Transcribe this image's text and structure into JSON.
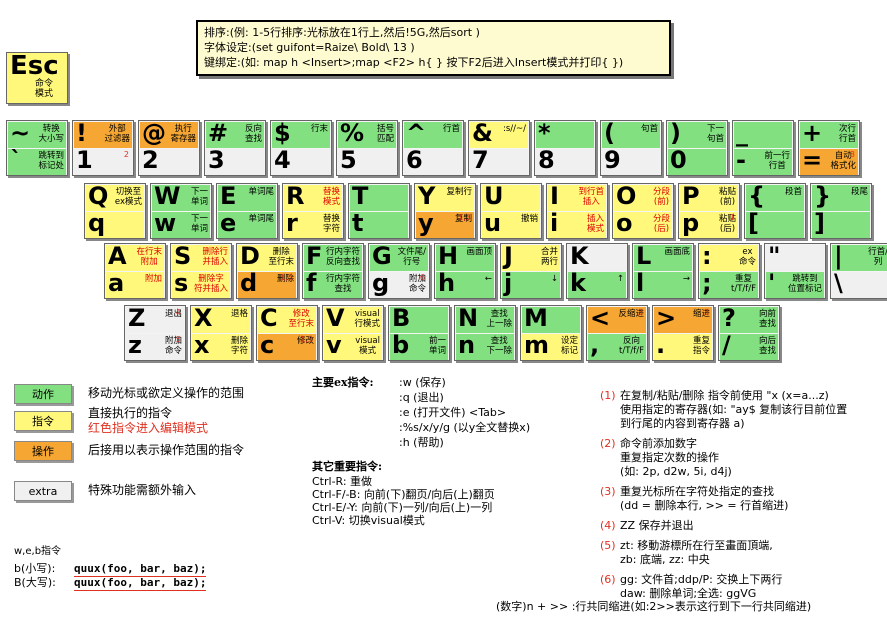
{
  "tips": [
    "排序:(例: 1-5行排序:光标放在1行上,然后!5G,然后sort )",
    "字体设定:(set guifont=Raize\\ Bold\\ 13 )",
    "键绑定:(如: map h <Insert>;map <F2> h{ } 按下F2后进入Insert模式并打印{ })"
  ],
  "esc": {
    "char": "Esc",
    "label": "命令\n模式"
  },
  "keys": [
    {
      "t": {
        "c": "~",
        "l": "转换\n大小写",
        "k": "g"
      },
      "b": {
        "c": "`",
        "l": "跳转到\n标记处",
        "k": "g"
      }
    },
    {
      "t": {
        "c": "!",
        "l": "外部\n过滤器",
        "k": "o"
      },
      "b": {
        "c": "1",
        "l": "",
        "k": "w",
        "n": "2"
      }
    },
    {
      "t": {
        "c": "@",
        "l": "执行\n寄存器",
        "k": "o"
      },
      "b": {
        "c": "2",
        "l": "",
        "k": "w"
      }
    },
    {
      "t": {
        "c": "#",
        "l": "反向\n查找",
        "k": "g"
      },
      "b": {
        "c": "3",
        "l": "",
        "k": "w"
      }
    },
    {
      "t": {
        "c": "$",
        "l": "行末",
        "k": "g"
      },
      "b": {
        "c": "4",
        "l": "",
        "k": "w"
      }
    },
    {
      "t": {
        "c": "%",
        "l": "括号\n匹配",
        "k": "g"
      },
      "b": {
        "c": "5",
        "l": "",
        "k": "w"
      }
    },
    {
      "t": {
        "c": "^",
        "l": "行首",
        "k": "g"
      },
      "b": {
        "c": "6",
        "l": "",
        "k": "w"
      }
    },
    {
      "t": {
        "c": "&",
        "l": ":s//~/",
        "k": "y"
      },
      "b": {
        "c": "7",
        "l": "",
        "k": "w"
      }
    },
    {
      "t": {
        "c": "*",
        "l": "",
        "k": "g"
      },
      "b": {
        "c": "8",
        "l": "",
        "k": "w"
      }
    },
    {
      "t": {
        "c": "(",
        "l": "句首",
        "k": "g"
      },
      "b": {
        "c": "9",
        "l": "",
        "k": "w"
      }
    },
    {
      "t": {
        "c": ")",
        "l": "下一\n句首",
        "k": "g"
      },
      "b": {
        "c": "0",
        "l": "",
        "k": "g"
      }
    },
    {
      "t": {
        "c": "_",
        "l": "",
        "k": "g"
      },
      "b": {
        "c": "-",
        "l": "前一行\n行首",
        "k": "g"
      }
    },
    {
      "t": {
        "c": "+",
        "l": "次行\n行首",
        "k": "g"
      },
      "b": {
        "c": "=",
        "l": "自动\n格式化",
        "k": "o",
        "n": "3"
      }
    }
  ],
  "row2": [
    {
      "t": {
        "c": "Q",
        "l": "切换至\nex模式",
        "k": "y"
      },
      "b": {
        "c": "q",
        "l": "",
        "k": "y"
      }
    },
    {
      "t": {
        "c": "W",
        "l": "下一\n单词",
        "k": "g"
      },
      "b": {
        "c": "w",
        "l": "下一\n单词",
        "k": "g"
      }
    },
    {
      "t": {
        "c": "E",
        "l": "单词尾",
        "k": "g"
      },
      "b": {
        "c": "e",
        "l": "单词尾",
        "k": "g"
      }
    },
    {
      "t": {
        "c": "R",
        "l": "替换\n模式",
        "k": "y",
        "r": true
      },
      "b": {
        "c": "r",
        "l": "替换\n字符",
        "k": "y"
      }
    },
    {
      "t": {
        "c": "T",
        "l": "",
        "k": "g"
      },
      "b": {
        "c": "t",
        "l": "",
        "k": "g"
      }
    },
    {
      "t": {
        "c": "Y",
        "l": "复制行",
        "k": "y"
      },
      "b": {
        "c": "y",
        "l": "复制",
        "k": "o",
        "n": "1,3"
      }
    },
    {
      "t": {
        "c": "U",
        "l": "",
        "k": "y"
      },
      "b": {
        "c": "u",
        "l": "撤销",
        "k": "y"
      }
    },
    {
      "t": {
        "c": "I",
        "l": "到行首\n插入",
        "k": "y",
        "r": true
      },
      "b": {
        "c": "i",
        "l": "插入\n模式",
        "k": "y",
        "r": true
      }
    },
    {
      "t": {
        "c": "O",
        "l": "分段\n(前)",
        "k": "y",
        "r": true
      },
      "b": {
        "c": "o",
        "l": "分段\n(后)",
        "k": "y",
        "r": true
      }
    },
    {
      "t": {
        "c": "P",
        "l": "粘贴\n(前)",
        "k": "y"
      },
      "b": {
        "c": "p",
        "l": "粘贴\n(后)",
        "k": "y",
        "n": "1"
      }
    },
    {
      "t": {
        "c": "{",
        "l": "段首",
        "k": "g"
      },
      "b": {
        "c": "[",
        "l": "",
        "k": "g"
      }
    },
    {
      "t": {
        "c": "}",
        "l": "段尾",
        "k": "g"
      },
      "b": {
        "c": "]",
        "l": "",
        "k": "g"
      }
    }
  ],
  "row3": [
    {
      "t": {
        "c": "A",
        "l": "在行末\n附加",
        "k": "y",
        "r": true
      },
      "b": {
        "c": "a",
        "l": "附加",
        "k": "y",
        "r": true
      }
    },
    {
      "t": {
        "c": "S",
        "l": "删除行\n并插入",
        "k": "y",
        "r": true
      },
      "b": {
        "c": "s",
        "l": "删除字\n符并插入",
        "k": "y",
        "r": true
      }
    },
    {
      "t": {
        "c": "D",
        "l": "删除\n至行末",
        "k": "y"
      },
      "b": {
        "c": "d",
        "l": "删除",
        "k": "o",
        "n": "1,3"
      }
    },
    {
      "t": {
        "c": "F",
        "l": "行内字符\n反向查找",
        "k": "g"
      },
      "b": {
        "c": "f",
        "l": "行内字符\n查找",
        "k": "g"
      }
    },
    {
      "t": {
        "c": "G",
        "l": "文件尾/\n行号",
        "k": "g"
      },
      "b": {
        "c": "g",
        "l": "附加\n命令",
        "k": "w",
        "n": "6"
      }
    },
    {
      "t": {
        "c": "H",
        "l": "画面顶",
        "k": "g"
      },
      "b": {
        "c": "h",
        "l": "←",
        "k": "g"
      }
    },
    {
      "t": {
        "c": "J",
        "l": "合并\n两行",
        "k": "y"
      },
      "b": {
        "c": "j",
        "l": "↓",
        "k": "g"
      }
    },
    {
      "t": {
        "c": "K",
        "l": "",
        "k": "w"
      },
      "b": {
        "c": "k",
        "l": "↑",
        "k": "g"
      }
    },
    {
      "t": {
        "c": "L",
        "l": "画面底",
        "k": "g"
      },
      "b": {
        "c": "l",
        "l": "→",
        "k": "g"
      }
    },
    {
      "t": {
        "c": ":",
        "l": "ex\n命令",
        "k": "y"
      },
      "b": {
        "c": ";",
        "l": "重复\nt/T/f/F",
        "k": "g"
      }
    },
    {
      "t": {
        "c": "\"",
        "l": "",
        "k": "w"
      },
      "b": {
        "c": "'",
        "l": "跳转到\n位置标记",
        "k": "g"
      }
    },
    {
      "t": {
        "c": "|",
        "l": "行首/\n列",
        "k": "g"
      },
      "b": {
        "c": "\\",
        "l": "",
        "k": "w"
      }
    }
  ],
  "row4": [
    {
      "t": {
        "c": "Z",
        "l": "退出",
        "k": "w",
        "n": "4"
      },
      "b": {
        "c": "z",
        "l": "附加\n命令",
        "k": "w",
        "n": "5"
      }
    },
    {
      "t": {
        "c": "X",
        "l": "退格",
        "k": "y"
      },
      "b": {
        "c": "x",
        "l": "删除\n字符",
        "k": "y"
      }
    },
    {
      "t": {
        "c": "C",
        "l": "修改\n至行末",
        "k": "y",
        "r": true
      },
      "b": {
        "c": "c",
        "l": "修改",
        "k": "o",
        "n": "1,3"
      }
    },
    {
      "t": {
        "c": "V",
        "l": "visual\n行模式",
        "k": "y"
      },
      "b": {
        "c": "v",
        "l": "visual\n模式",
        "k": "y"
      }
    },
    {
      "t": {
        "c": "B",
        "l": "",
        "k": "g"
      },
      "b": {
        "c": "b",
        "l": "前一\n单词",
        "k": "g"
      }
    },
    {
      "t": {
        "c": "N",
        "l": "查找\n上一除",
        "k": "g"
      },
      "b": {
        "c": "n",
        "l": "查找\n下一除",
        "k": "g"
      }
    },
    {
      "t": {
        "c": "M",
        "l": "",
        "k": "g"
      },
      "b": {
        "c": "m",
        "l": "设定\n标记",
        "k": "y"
      }
    },
    {
      "t": {
        "c": "<",
        "l": "反缩进",
        "k": "o",
        "n": "3"
      },
      "b": {
        "c": ",",
        "l": "反向\nt/T/f/F",
        "k": "g"
      }
    },
    {
      "t": {
        "c": ">",
        "l": "缩进",
        "k": "o",
        "n": "3"
      },
      "b": {
        "c": ".",
        "l": "重复\n指令",
        "k": "y"
      }
    },
    {
      "t": {
        "c": "?",
        "l": "向前\n查找",
        "k": "g"
      },
      "b": {
        "c": "/",
        "l": "向后\n查找",
        "k": "g"
      }
    }
  ],
  "legend": [
    {
      "label": "动作",
      "text": "移动光标或欲定义操作的范围",
      "k": "g"
    },
    {
      "label": "指令",
      "text": "直接执行的指令",
      "text2": "红色指令进入编辑模式",
      "k": "y"
    },
    {
      "label": "操作",
      "text": "后接用以表示操作范围的指令",
      "k": "o"
    },
    {
      "label": "extra",
      "text": "特殊功能需额外输入",
      "k": "w"
    }
  ],
  "ex": {
    "title": "主要ex指令:",
    "items": [
      ":w (保存)",
      ":q (退出)",
      ":e (打开文件) <Tab>",
      ":%s/x/y/g (以y全文替换x)",
      ":h (帮助)"
    ]
  },
  "other": {
    "title": "其它重要指令:",
    "items": [
      "Ctrl-R: 重做",
      "Ctrl-F/-B: 向前(下)翻页/向后(上)翻页",
      "Ctrl-E/-Y: 向前(下)一列/向后(上)一列",
      "Ctrl-V: 切换visual模式"
    ]
  },
  "notes": [
    {
      "n": "(1)",
      "lines": [
        "在复制/粘贴/删除 指令前使用 \"x (x=a...z)",
        "使用指定的寄存器(如: \"ay$ 复制该行目前位置",
        "到行尾的内容到寄存器 a)"
      ]
    },
    {
      "n": "(2)",
      "lines": [
        "命令前添加数字",
        "重复指定次数的操作",
        "(如: 2p, d2w, 5i, d4j)"
      ]
    },
    {
      "n": "(3)",
      "lines": [
        "重复光标所在字符处指定的查找",
        "(dd = 删除本行, >> = 行首缩进)"
      ]
    },
    {
      "n": "(4)",
      "lines": [
        "ZZ 保存并退出"
      ]
    },
    {
      "n": "(5)",
      "lines": [
        "zt: 移動游標所在行至畫面頂端,",
        "zb: 底端, zz: 中央"
      ]
    },
    {
      "n": "(6)",
      "lines": [
        "gg: 文件首;ddp/P: 交换上下两行",
        "daw: 删除单词;全选: ggVG"
      ]
    }
  ],
  "wordmove": {
    "title": "w,e,b指令",
    "small": "b(小写):",
    "big": "B(大写):",
    "code": "quux(foo, bar, baz);"
  },
  "footer": "(数字)n + >> :行共同缩进(如:2>>表示这行到下一行共同缩进)"
}
